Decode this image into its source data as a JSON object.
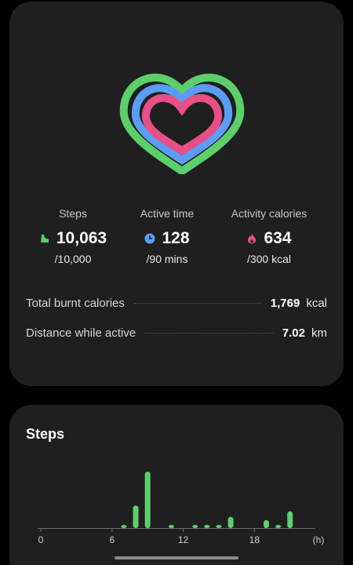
{
  "summary": {
    "stats": [
      {
        "label": "Steps",
        "value": "10,063",
        "goal": "/10,000",
        "icon": "shoe-icon",
        "color": "#5ccf6b"
      },
      {
        "label": "Active time",
        "value": "128",
        "goal": "/90 mins",
        "icon": "clock-icon",
        "color": "#5b9cf5"
      },
      {
        "label": "Activity calories",
        "value": "634",
        "goal": "/300 kcal",
        "icon": "flame-icon",
        "color": "#e84f86"
      }
    ],
    "total_burnt": {
      "label": "Total burnt calories",
      "value": "1,769",
      "unit": "kcal"
    },
    "distance": {
      "label": "Distance while active",
      "value": "7.02",
      "unit": "km"
    }
  },
  "steps_card": {
    "title": "Steps"
  },
  "chart_data": {
    "type": "bar",
    "x_ticks": [
      "0",
      "6",
      "12",
      "18"
    ],
    "x_unit": "(h)",
    "hours": [
      7,
      8,
      9,
      11,
      13,
      14,
      15,
      16,
      19,
      20,
      21
    ],
    "values": [
      4,
      28,
      70,
      4,
      4,
      4,
      4,
      14,
      10,
      4,
      21
    ],
    "ylim": [
      0,
      75
    ],
    "color": "#5ccf6b"
  },
  "colors": {
    "green": "#5ccf6b",
    "blue": "#5b9cf5",
    "pink": "#e84f86",
    "card": "#1f1f1f"
  }
}
